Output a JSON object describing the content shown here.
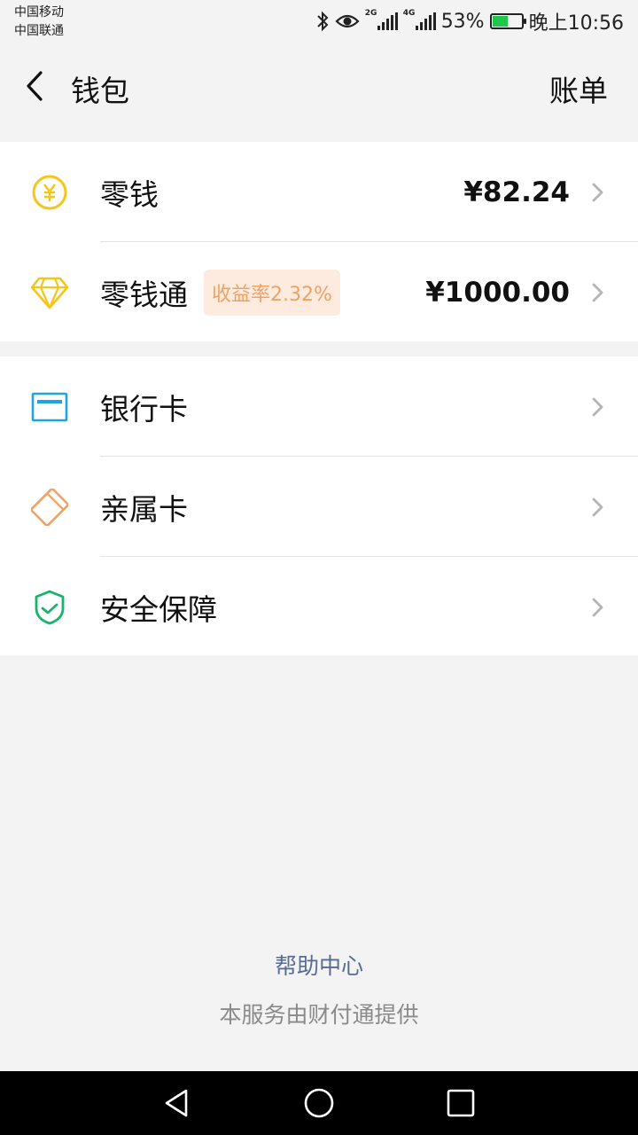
{
  "status_bar": {
    "carrier_1": "中国移动",
    "carrier_2": "中国联通",
    "net_1": "2G",
    "net_2": "4G",
    "battery_percent_text": "53%",
    "battery_level": 0.53,
    "time": "晚上10:56",
    "icons": [
      "bluetooth-icon",
      "eye-icon",
      "signal-icon",
      "signal-icon",
      "battery-icon"
    ]
  },
  "header": {
    "back_icon": "chevron-left-icon",
    "title": "钱包",
    "bill_label": "账单"
  },
  "wallet_items": [
    {
      "label": "零钱",
      "amount": "¥82.24",
      "icon": "yuan-coin-icon",
      "color": "#f5c518"
    },
    {
      "label": "零钱通",
      "badge": "收益率2.32%",
      "amount": "¥1000.00",
      "icon": "diamond-icon",
      "color": "#f5c518"
    }
  ],
  "service_items": [
    {
      "label": "银行卡",
      "icon": "bank-card-icon",
      "color": "#1fa3e3"
    },
    {
      "label": "亲属卡",
      "icon": "family-card-icon",
      "color": "#f0a263"
    },
    {
      "label": "安全保障",
      "icon": "shield-check-icon",
      "color": "#1bb36b"
    }
  ],
  "footer": {
    "help_label": "帮助中心",
    "provider_text": "本服务由财付通提供"
  },
  "nav_bar": {
    "icons": [
      "back-triangle-icon",
      "home-circle-icon",
      "recents-square-icon"
    ]
  },
  "colors": {
    "background": "#f3f3f3",
    "link": "#576b95",
    "badge_bg": "#fcebde",
    "badge_text": "#f0a263"
  }
}
